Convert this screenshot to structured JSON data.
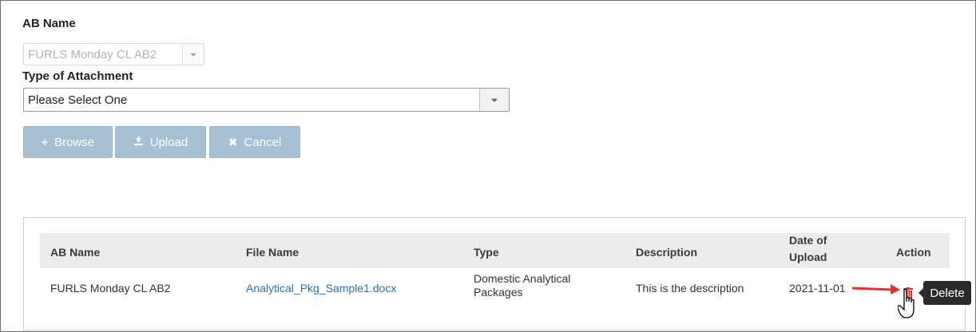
{
  "form": {
    "ab_name_label": "AB Name",
    "ab_name_value": "FURLS Monday CL AB2",
    "attachment_label": "Type of Attachment",
    "attachment_value": "Please Select One"
  },
  "buttons": {
    "browse": "Browse",
    "upload": "Upload",
    "cancel": "Cancel"
  },
  "table": {
    "headers": {
      "ab_name": "AB Name",
      "file_name": "File Name",
      "type": "Type",
      "description": "Description",
      "date_line1": "Date of",
      "date_line2": "Upload",
      "action": "Action"
    },
    "rows": [
      {
        "ab_name": "FURLS Monday CL AB2",
        "file_name": "Analytical_Pkg_Sample1.docx",
        "type_line1": "Domestic Analytical",
        "type_line2": "Packages",
        "description": "This is the description",
        "date": "2021-11-01"
      }
    ]
  },
  "tooltip": {
    "delete": "Delete"
  },
  "icons": {
    "browse": "plus-icon",
    "upload": "upload-icon",
    "cancel": "close-icon",
    "action": "trash-icon",
    "pointer": "hand-pointer-icon",
    "annotation": "red-arrow-icon"
  },
  "colors": {
    "button_bg": "#a8c0d4",
    "link": "#2a6fb5",
    "delete_icon": "#d9352b",
    "annotation_arrow": "#e8302a"
  }
}
